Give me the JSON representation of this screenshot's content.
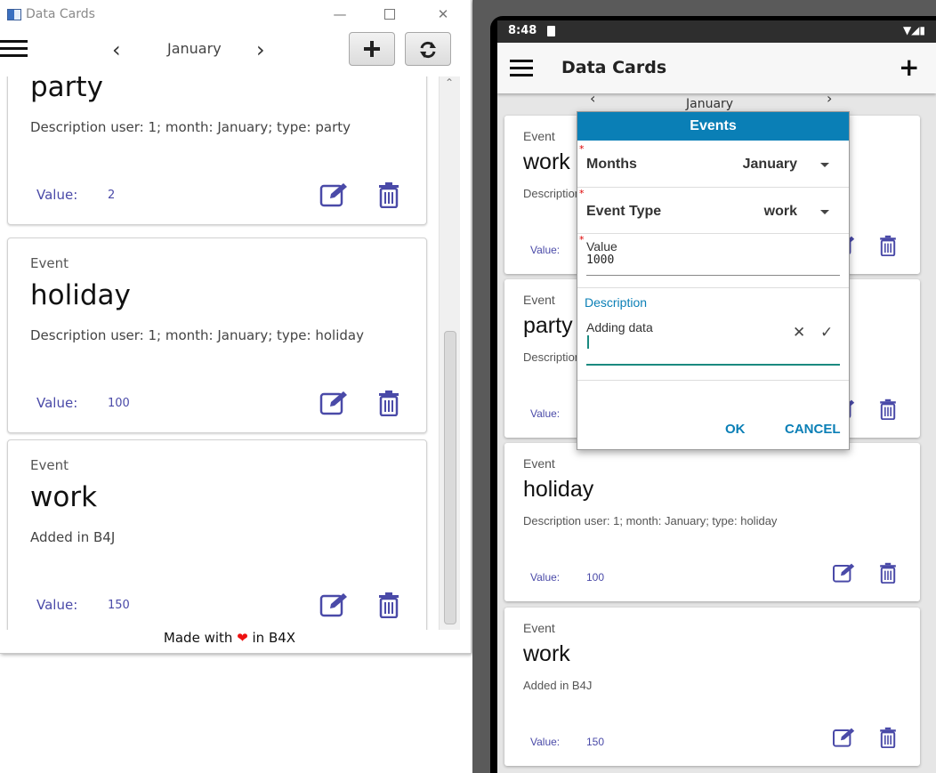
{
  "desktop": {
    "window_title": "Data Cards",
    "toolbar": {
      "month": "January",
      "prev_glyph": "‹",
      "next_glyph": "›"
    },
    "cards": [
      {
        "event": "",
        "title": "party",
        "description": "Description user: 1; month: January; type: party",
        "value_label": "Value:",
        "value": "2"
      },
      {
        "event": "Event",
        "title": "holiday",
        "description": "Description user: 1; month: January; type: holiday",
        "value_label": "Value:",
        "value": "100"
      },
      {
        "event": "Event",
        "title": "work",
        "description": "Added in B4J",
        "value_label": "Value:",
        "value": "150"
      }
    ],
    "footer": {
      "before": "Made with ",
      "heart": "❤",
      "after": " in B4X"
    }
  },
  "phone": {
    "status": {
      "time": "8:48",
      "icons": "▼◢▮"
    },
    "appbar": {
      "title": "Data Cards",
      "add": "+"
    },
    "nav": {
      "month": "January",
      "prev_glyph": "‹",
      "next_glyph": "›"
    },
    "cards": [
      {
        "event": "Event",
        "title": "work",
        "description": "Description",
        "value_label": "Value:",
        "value": ""
      },
      {
        "event": "Event",
        "title": "party",
        "description": "Description",
        "value_label": "Value:",
        "value": ""
      },
      {
        "event": "Event",
        "title": "holiday",
        "description": "Description user: 1; month: January; type: holiday",
        "value_label": "Value:",
        "value": "100"
      },
      {
        "event": "Event",
        "title": "work",
        "description": "Added in B4J",
        "value_label": "Value:",
        "value": "150"
      }
    ],
    "dialog": {
      "title": "Events",
      "months_label": "Months",
      "months_value": "January",
      "type_label": "Event Type",
      "type_value": "work",
      "value_label": "Value",
      "value_value": "1000",
      "description_label": "Description",
      "description_value": "Adding data",
      "clear_glyph": "✕",
      "accept_glyph": "✓",
      "ok": "OK",
      "cancel": "CANCEL",
      "required_mark": "*"
    }
  },
  "colors": {
    "accent": "#0a7fb6",
    "value_text": "#4a4aa8",
    "icon": "#4a4aa8",
    "heart": "#e11111"
  }
}
